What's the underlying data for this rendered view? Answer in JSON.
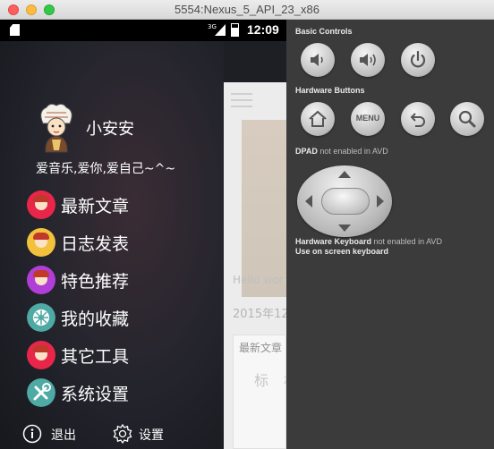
{
  "window": {
    "title": "5554:Nexus_5_API_23_x86"
  },
  "statusbar": {
    "signal": "3G",
    "time": "12:09"
  },
  "drawer": {
    "username": "小安安",
    "motto": "爱音乐,爱你,爱自己~^~",
    "items": [
      {
        "label": "最新文章",
        "color": "#e8264a"
      },
      {
        "label": "日志发表",
        "color": "#f2c23c"
      },
      {
        "label": "特色推荐",
        "color": "#b13ed6"
      },
      {
        "label": "我的收藏",
        "color": "#4fa9a4"
      },
      {
        "label": "其它工具",
        "color": "#e8264a"
      },
      {
        "label": "系统设置",
        "color": "#4fa9a4"
      }
    ],
    "logout_label": "退出",
    "settings_label": "设置"
  },
  "app": {
    "hello": "Hello wor",
    "date": "2015年12",
    "card_title": "最新文章",
    "card_sub": "标 札"
  },
  "avd": {
    "basic_controls": "Basic Controls",
    "hardware_buttons": "Hardware Buttons",
    "menu_label": "MENU",
    "dpad_title": "DPAD",
    "dpad_note": "not enabled in AVD",
    "keyboard_title": "Hardware Keyboard",
    "keyboard_note": "not enabled in AVD",
    "keyboard_option": "Use on screen keyboard"
  }
}
